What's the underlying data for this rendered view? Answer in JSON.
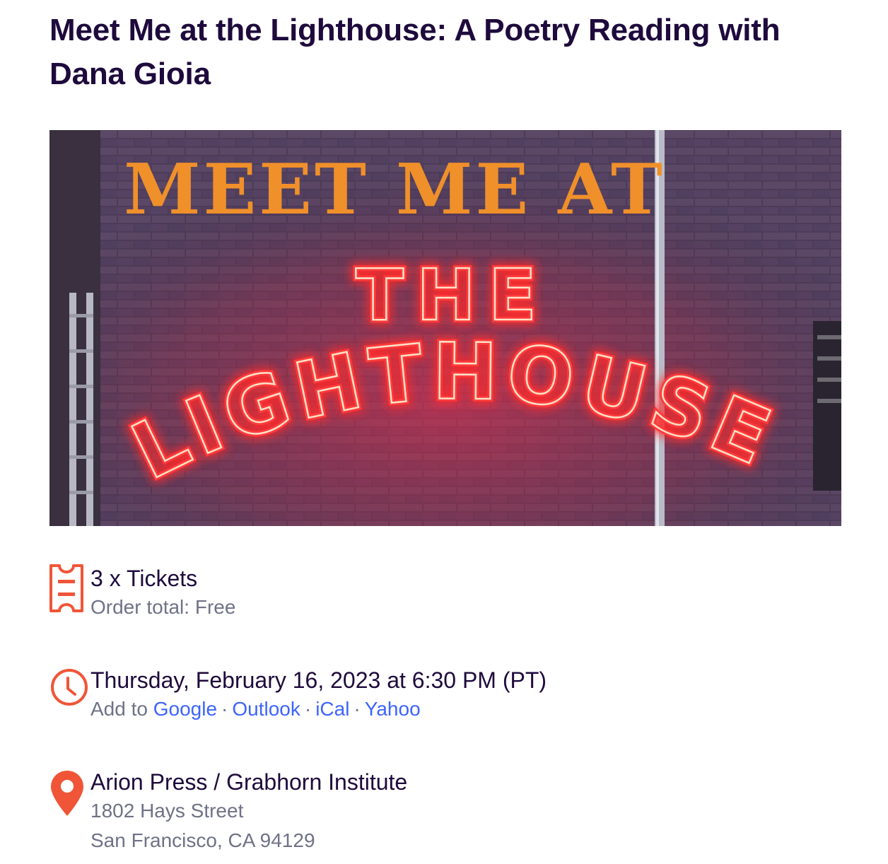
{
  "event": {
    "title": "Meet Me at the Lighthouse: A Poetry Reading with Dana Gioia"
  },
  "banner": {
    "top_text": "MEET ME AT",
    "neon_line_1": "THE",
    "neon_line_2": "LIGHTHOUSE",
    "colors": {
      "top_text": "#f0902a",
      "neon": "#ff2a2a",
      "neon_core": "#ffe0c8",
      "wall": "#4a3a55"
    }
  },
  "tickets": {
    "icon": "ticket-icon",
    "label": "3 x Tickets",
    "order_total": "Order total: Free"
  },
  "datetime": {
    "icon": "clock-icon",
    "label": "Thursday, February 16, 2023 at 6:30 PM (PT)",
    "add_to_prefix": "Add to",
    "calendars": [
      "Google",
      "Outlook",
      "iCal",
      "Yahoo"
    ],
    "separator": "·"
  },
  "location": {
    "icon": "map-pin-icon",
    "venue": "Arion Press / Grabhorn Institute",
    "street": "1802 Hays Street",
    "city": "San Francisco, CA 94129"
  },
  "colors": {
    "title": "#1e0a3c",
    "accent": "#f05537",
    "link": "#3d64ff",
    "muted": "#6f7287"
  }
}
